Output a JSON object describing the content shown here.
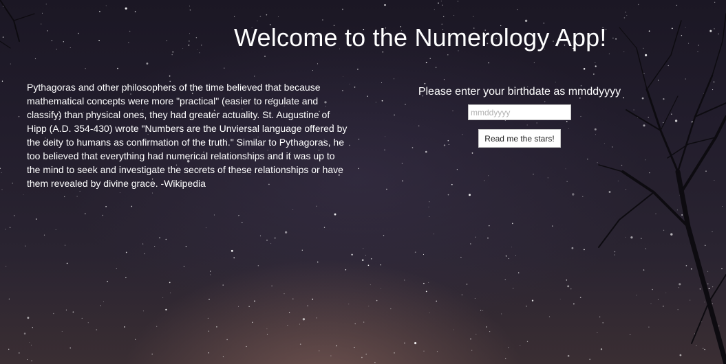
{
  "header": {
    "title": "Welcome to the Numerology App!"
  },
  "intro": {
    "text": "Pythagoras and other philosophers of the time believed that because mathematical concepts were more \"practical\" (easier to regulate and classify) than physical ones, they had greater actuality. St. Augustine of Hipp (A.D. 354-430) wrote \"Numbers are the Unviersal language offered by the deity to humans as confirmation of the truth.\" Similar to Pythagoras, he too believed that everything had numerical relationships and it was up to the mind to seek and investigate the secrets of these relationships or have them revealed by divine grace. -Wikipedia"
  },
  "form": {
    "prompt": "Please enter your birthdate as mmddyyyy",
    "input_value": "",
    "input_placeholder": "mmddyyyy",
    "button_label": "Read me the stars!"
  },
  "colors": {
    "text": "#ffffff",
    "sky_dark": "#1b1724",
    "sky_glow": "#3a2e33"
  }
}
